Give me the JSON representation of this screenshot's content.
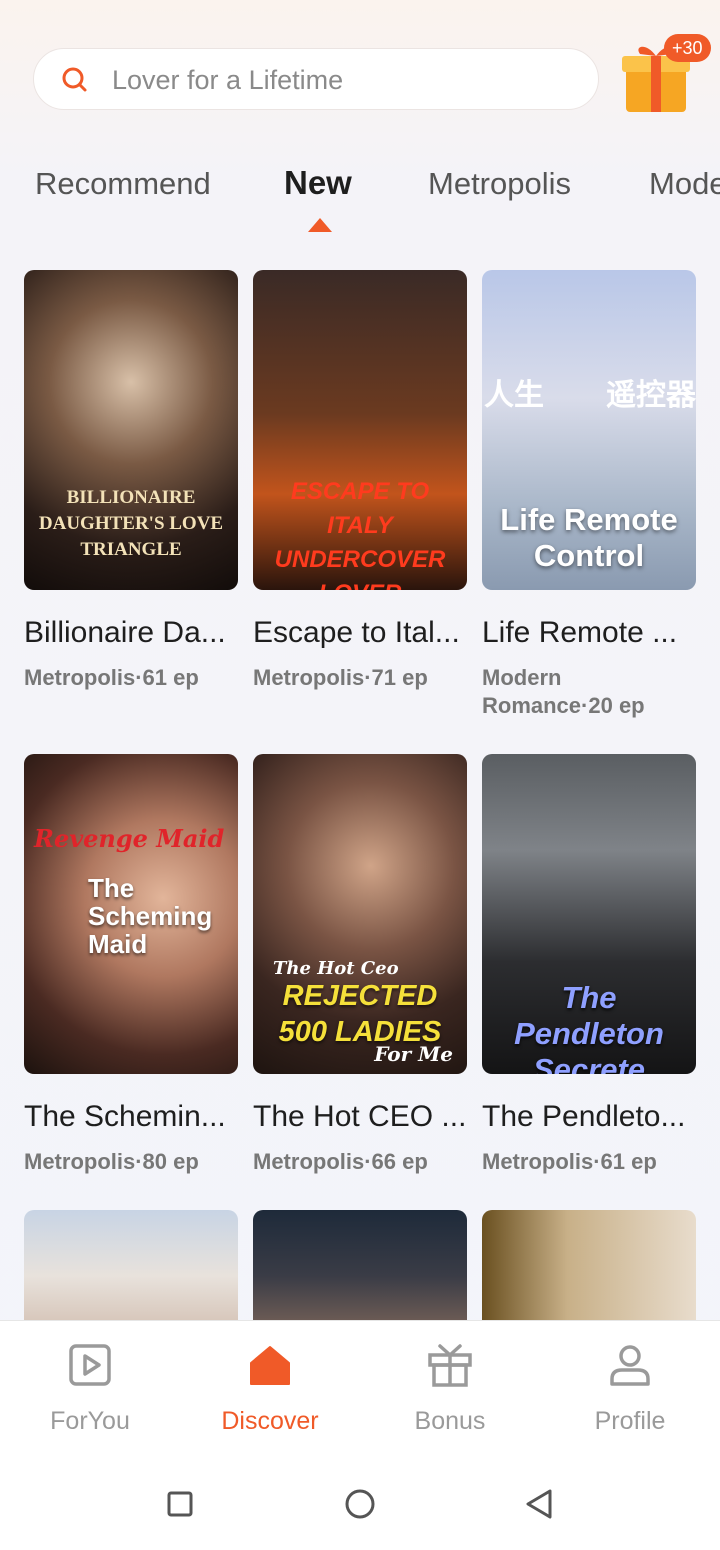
{
  "search": {
    "placeholder": "Lover for a Lifetime"
  },
  "gift": {
    "badge": "+30"
  },
  "tabs": [
    {
      "label": "Recommend",
      "active": false
    },
    {
      "label": "New",
      "active": true
    },
    {
      "label": "Metropolis",
      "active": false
    },
    {
      "label": "Mode",
      "active": false
    }
  ],
  "cards": [
    {
      "title": "Billionaire Da...",
      "meta": "Metropolis·61 ep",
      "poster_text": "BILLIONAIRE DAUGHTER'S LOVE TRIANGLE"
    },
    {
      "title": "Escape to Ital...",
      "meta": "Metropolis·71 ep",
      "poster_text": "ESCAPE TO ITALY UNDERCOVER LOVER"
    },
    {
      "title": "Life Remote ...",
      "meta": "Modern Romance·20 ep",
      "poster_text": "Life Remote Control",
      "poster_cn_left": "人生",
      "poster_cn_right": "遥控器"
    },
    {
      "title": "The Schemin...",
      "meta": "Metropolis·80 ep",
      "poster_text": "The Scheming Maid",
      "poster_script": "Revenge Maid"
    },
    {
      "title": "The Hot CEO ...",
      "meta": "Metropolis·66 ep",
      "poster_text": "REJECTED 500 LADIES",
      "poster_script": "The Hot Ceo",
      "poster_script2": "For Me"
    },
    {
      "title": "The Pendleto...",
      "meta": "Metropolis·61 ep",
      "poster_text": "The Pendleton Secrete"
    }
  ],
  "nav": [
    {
      "label": "ForYou",
      "icon": "play-square-icon",
      "active": false
    },
    {
      "label": "Discover",
      "icon": "home-icon",
      "active": true
    },
    {
      "label": "Bonus",
      "icon": "gift-icon",
      "active": false
    },
    {
      "label": "Profile",
      "icon": "person-icon",
      "active": false
    }
  ],
  "colors": {
    "accent": "#f05a28"
  }
}
